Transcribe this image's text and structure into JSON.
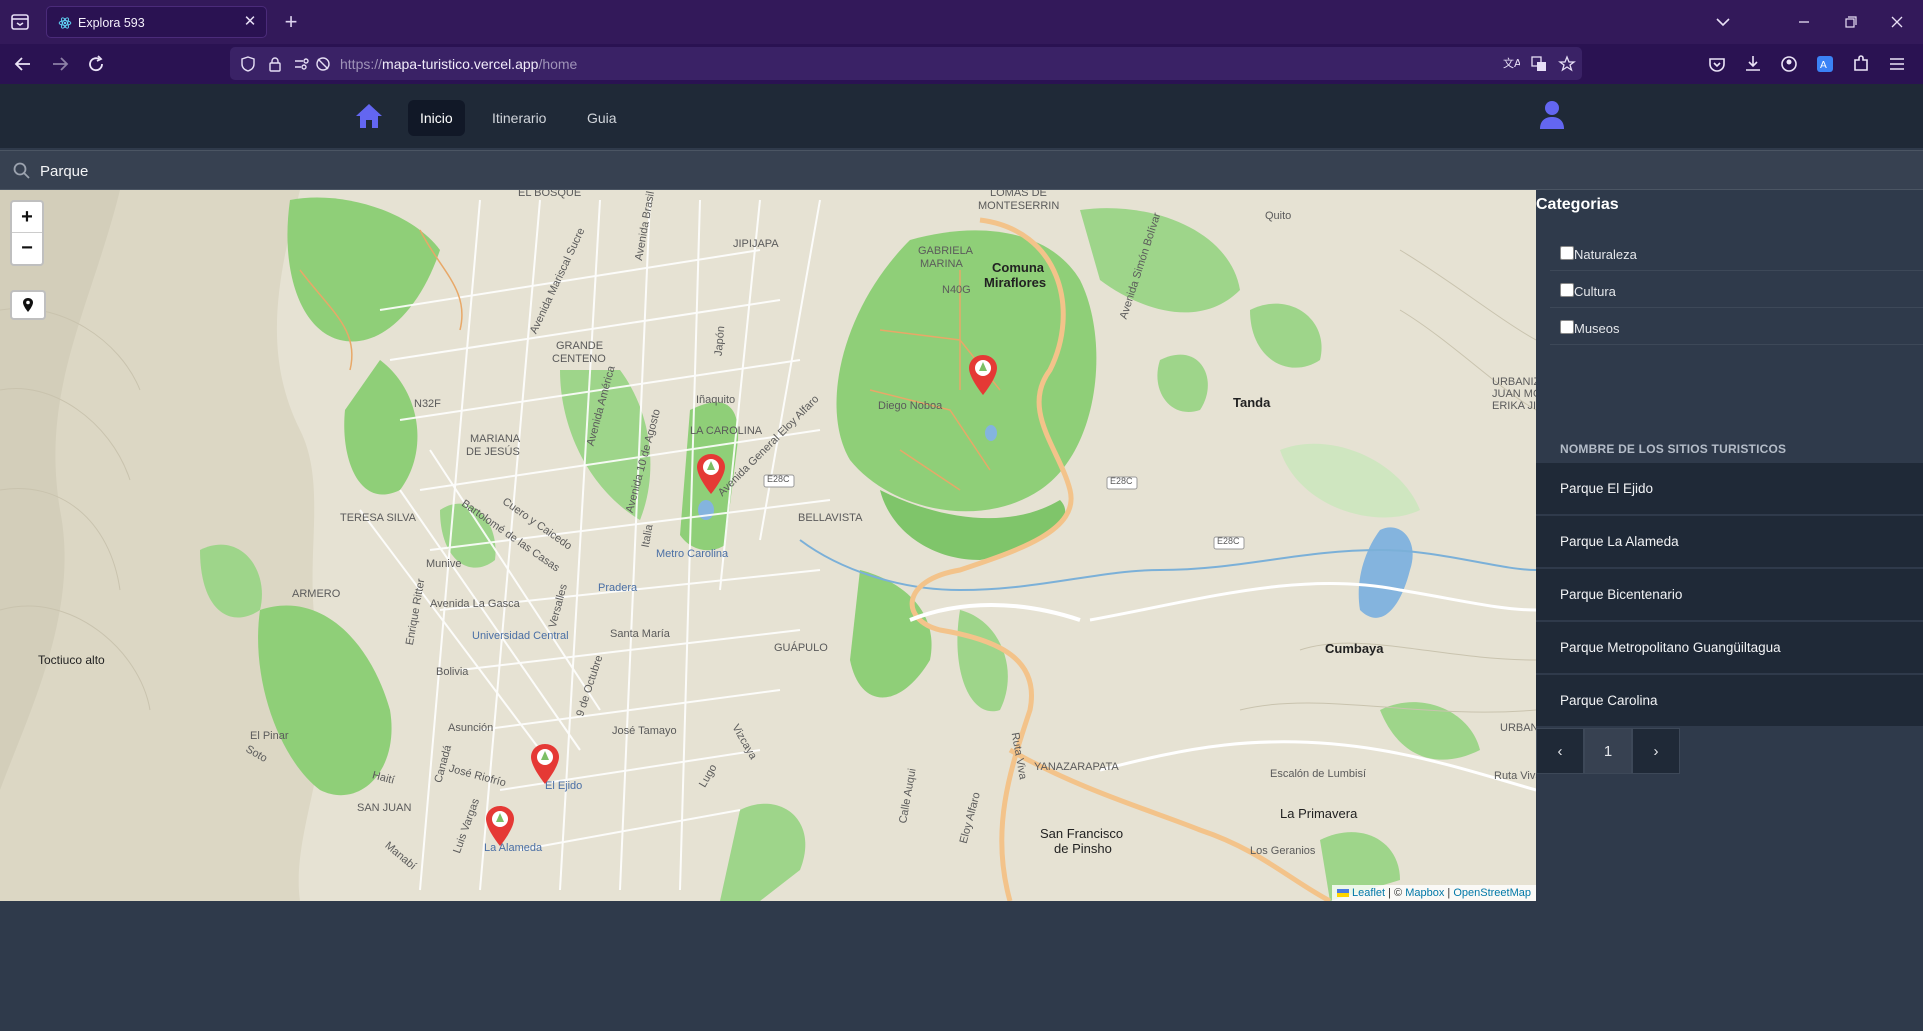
{
  "browser": {
    "tab_title": "Explora 593",
    "url_prefix": "https://",
    "url_host": "mapa-turistico.vercel.app",
    "url_path": "/home"
  },
  "nav": {
    "items": [
      {
        "label": "Inicio",
        "active": true
      },
      {
        "label": "Itinerario",
        "active": false
      },
      {
        "label": "Guia",
        "active": false
      }
    ]
  },
  "search": {
    "value": "Parque"
  },
  "map": {
    "labels": {
      "el_bosque": "EL BOSQUE",
      "lomas": "LOMAS DE",
      "monteserrin": "MONTESERRIN",
      "jipijapa": "JIPIJAPA",
      "gabriela": "GABRIELA",
      "marina": "MARINA",
      "n40g": "N40G",
      "comuna1": "Comuna",
      "comuna2": "Miraflores",
      "quito": "Quito",
      "grande1": "GRANDE",
      "grande2": "CENTENO",
      "japon": "Japón",
      "n32f": "N32F",
      "inaquito": "Iñaquito",
      "diego_noboa": "Diego Noboa",
      "mariana1": "MARIANA",
      "mariana2": "DE JESÚS",
      "tanda": "Tanda",
      "urbanizacion1": "URBANIZACIÓ",
      "urbanizacion2": "JUAN MONTAL",
      "urbanizacion3": "ERIKA JIMEN",
      "teresa": "TERESA SILVA",
      "bellavista": "BELLAVISTA",
      "e28c_1": "E28C",
      "e28c_2": "E28C",
      "e28c_3": "E28C",
      "metro_carolina": "Metro Carolina",
      "munive": "Munive",
      "pradera": "Pradera",
      "armero": "ARMERO",
      "avenida_gasca": "Avenida La Gasca",
      "santa_maria": "Santa María",
      "universidad": "Universidad Central",
      "guapulo": "GUÁPULO",
      "cumbaya": "Cumbaya",
      "toctiuco": "Toctiuco alto",
      "bolivia": "Bolivia",
      "asuncion": "Asunción",
      "el_pinar": "El Pinar",
      "jose_tamayo": "José Tamayo",
      "vizcaya": "Vizcaya",
      "urbani": "URBANI",
      "yanazarapata": "YANAZARAPATA",
      "escalon": "Escalón de Lumbisí",
      "el_ejido": "El Ejido",
      "san_juan": "SAN JUAN",
      "la_primavera": "La Primavera",
      "la_alameda": "La Alameda",
      "san_francisco1": "San Francisco",
      "san_francisco2": "de Pinsho",
      "los_geranios": "Los Geranios",
      "ruta_viva": "Ruta Viva",
      "avenida_brasil": "Avenida Brasil",
      "av_america": "Avenida América",
      "av_10_agosto": "Avenida 10 de Agosto",
      "av_eloy_alfaro": "Avenida General Eloy Alfaro",
      "av_simon_bolivar": "Avenida Simón Bolívar",
      "av_mariscal_sucre": "Avenida Mariscal Sucre",
      "calle_auqui": "Calle Auqui",
      "eloy_alfaro2": "Eloy Alfaro",
      "ruta_viva2": "Ruta Viva",
      "la_carolina": "LA CAROLINA",
      "bartolome": "Bartolomé de las Casas",
      "cuero": "Cuero y Caicedo",
      "versalles": "Versalles",
      "enrique_ritter": "Enrique Ritter",
      "9_octubre": "9 de Octubre",
      "canada": "Canadá",
      "jose_riofrio": "José Riofrío",
      "haiti": "Haití",
      "luis_vargas": "Luis Vargas",
      "manabi": "Manabí",
      "sodiro": "Soto",
      "italia": "Italia",
      "lugo": "Lugo"
    },
    "attribution": {
      "leaflet": "Leaflet",
      "sep1": " | © ",
      "mapbox": "Mapbox",
      "sep2": " | ",
      "osm": "OpenStreetMap"
    },
    "zoom_in": "+",
    "zoom_out": "−"
  },
  "sidebar": {
    "categories_title": "Categorias",
    "categories": [
      "Naturaleza",
      "Cultura",
      "Museos"
    ],
    "sites_title": "NOMBRE DE LOS SITIOS TURISTICOS",
    "sites": [
      "Parque El Ejido",
      "Parque La Alameda",
      "Parque Bicentenario",
      "Parque Metropolitano Guangüiltagua",
      "Parque Carolina"
    ],
    "pager": {
      "prev": "‹",
      "current": "1",
      "next": "›"
    }
  },
  "colors": {
    "app_header": "#1f2937",
    "accent": "#6366f1",
    "marker": "#e53935"
  }
}
